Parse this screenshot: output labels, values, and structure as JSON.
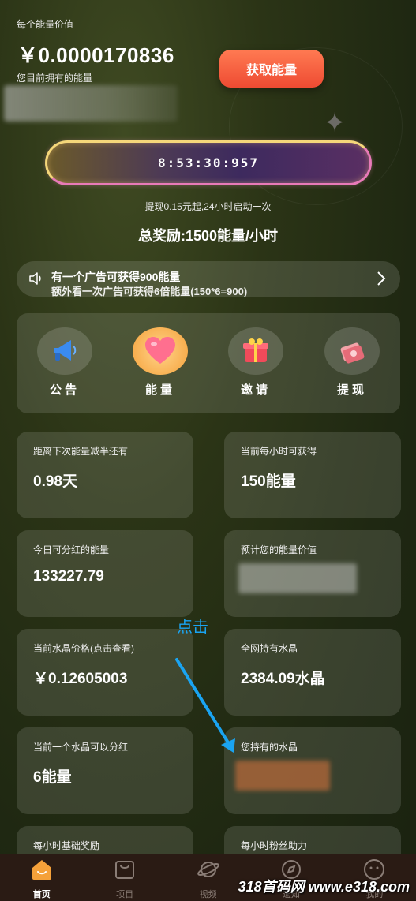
{
  "header": {
    "energy_value_label": "每个能量价值",
    "energy_value": "￥0.0000170836",
    "owned_energy_label": "您目前拥有的能量",
    "get_energy_button": "获取能量"
  },
  "timer": {
    "countdown": "8:53:30:957",
    "withdraw_note": "提现0.15元起,24小时启动一次",
    "total_reward": "总奖励:1500能量/小时"
  },
  "notice": {
    "line1": "有一个广告可获得900能量",
    "line2": "额外看一次广告可获得6倍能量(150*6=900)"
  },
  "nav": {
    "items": [
      {
        "label": "公告",
        "icon": "megaphone-icon"
      },
      {
        "label": "能量",
        "icon": "heart-icon"
      },
      {
        "label": "邀请",
        "icon": "gift-icon"
      },
      {
        "label": "提现",
        "icon": "money-icon"
      }
    ]
  },
  "stats": {
    "halving_label": "距离下次能量减半还有",
    "halving_value": "0.98天",
    "hourly_label": "当前每小时可获得",
    "hourly_value": "150能量",
    "dividend_today_label": "今日可分红的能量",
    "dividend_today_value": "133227.79",
    "estimated_value_label": "预计您的能量价值",
    "crystal_price_label": "当前水晶价格(点击查看)",
    "crystal_price_value": "￥0.12605003",
    "network_crystal_label": "全网持有水晶",
    "network_crystal_value": "2384.09水晶",
    "crystal_dividend_label": "当前一个水晶可以分红",
    "crystal_dividend_value": "6能量",
    "your_crystal_label": "您持有的水晶",
    "base_reward_label": "每小时基础奖励",
    "fan_boost_label": "每小时粉丝助力"
  },
  "hint": {
    "click_text": "点击"
  },
  "tabbar": {
    "tabs": [
      {
        "label": "首页",
        "icon": "home-icon"
      },
      {
        "label": "项目",
        "icon": "bag-icon"
      },
      {
        "label": "视频",
        "icon": "planet-icon"
      },
      {
        "label": "通知",
        "icon": "compass-icon"
      },
      {
        "label": "我的",
        "icon": "face-icon"
      }
    ]
  },
  "watermark": "318首码网 www.e318.com",
  "colors": {
    "accent_button": "#ee4b32",
    "hint_blue": "#1aa4f2",
    "tabbar_bg": "#2a1b14"
  }
}
